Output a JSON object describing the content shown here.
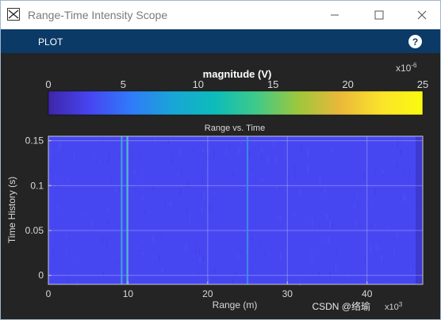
{
  "window": {
    "title": "Range-Time Intensity Scope",
    "app_icon": "scope-icon",
    "controls": [
      "minimize-icon",
      "maximize-icon",
      "close-icon"
    ]
  },
  "toolstrip": {
    "tabs": [
      {
        "label": "PLOT"
      }
    ],
    "help_glyph": "?"
  },
  "colorbar": {
    "label": "magnitude (V)",
    "ticks": [
      "0",
      "5",
      "10",
      "15",
      "20",
      "25"
    ],
    "exponent": "x10",
    "exponent_power": "-6",
    "colormap": [
      "#3e26a8",
      "#4745f2",
      "#2f7cf9",
      "#19a6d6",
      "#0cbcba",
      "#3fca89",
      "#9dc73d",
      "#e9b83a",
      "#fbe32b",
      "#f9fb0e"
    ]
  },
  "chart_data": {
    "type": "heatmap",
    "title": "Range vs. Time",
    "xlabel": "Range (m)",
    "ylabel": "Time History (s)",
    "xlim": [
      0,
      47
    ],
    "ylim": [
      -0.01,
      0.155
    ],
    "x_ticks": [
      "0",
      "10",
      "20",
      "30",
      "40"
    ],
    "y_ticks": [
      "0",
      "0.05",
      "0.1",
      "0.15"
    ],
    "x_exponent": "x10",
    "x_exponent_power": "3",
    "grid": true,
    "background_color": "#4747f2",
    "stripes": [
      {
        "range": 9.2,
        "color": "#3fb0d8"
      },
      {
        "range": 9.9,
        "color": "#47c7c9"
      },
      {
        "range": 25.0,
        "color": "#3f8fe8"
      }
    ]
  },
  "watermark": "CSDN @络瑜"
}
